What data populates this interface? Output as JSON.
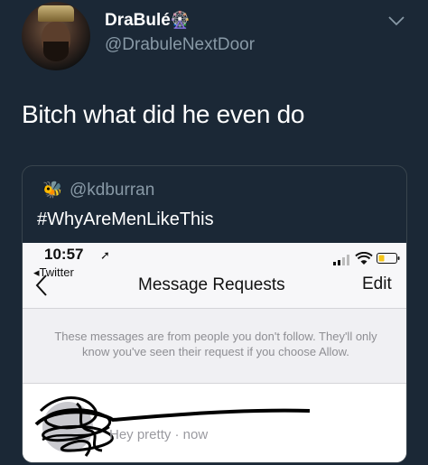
{
  "tweet": {
    "display_name": "DraBulé",
    "name_emoji": "🎡",
    "handle": "@DrabuleNextDoor",
    "text": "Bitch what did he even do",
    "menu_icon": "chevron-down-icon"
  },
  "quote": {
    "emoji": "🐝",
    "handle": "@kdburran",
    "text": "#WhyAreMenLikeThis"
  },
  "screenshot": {
    "status_time": "10:57",
    "location_glyph": "➚",
    "back_app": "◂Twitter",
    "nav_title": "Message Requests",
    "edit_label": "Edit",
    "info_text": "These messages are from people you don't follow. They'll only know you've seen their request if you choose Allow.",
    "row_preview": "Hey pretty · now"
  },
  "colors": {
    "background": "#1b2836",
    "secondary_text": "#8899a6",
    "card_border": "#38444d",
    "phone_bg": "#f7f7f9"
  }
}
